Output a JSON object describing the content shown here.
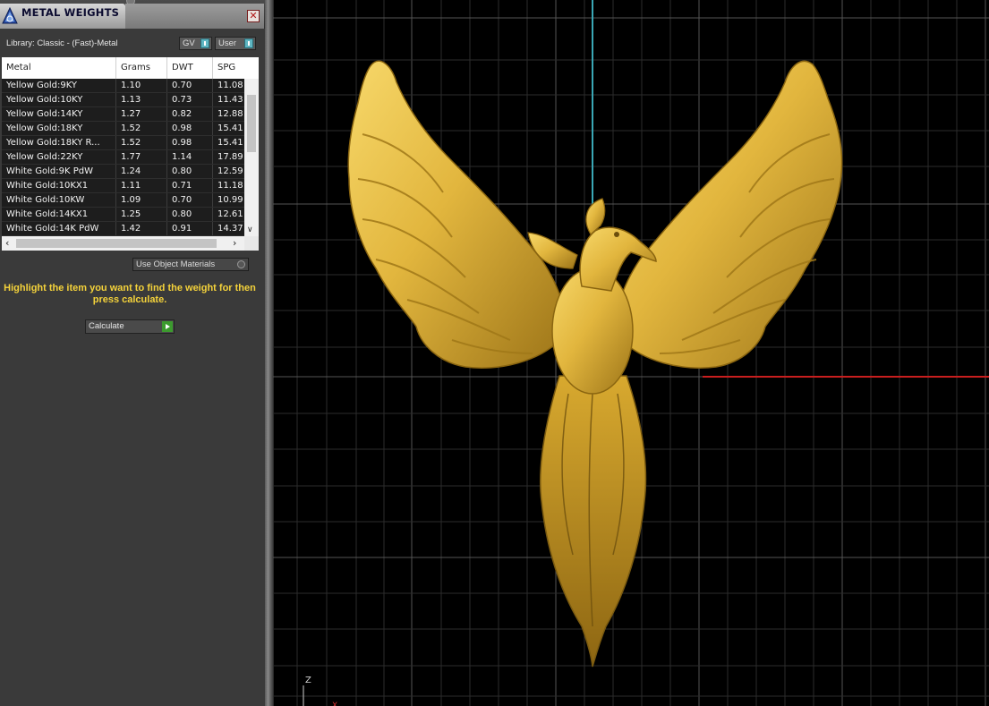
{
  "panel": {
    "title": "METAL WEIGHTS",
    "library": "Library: Classic - (Fast)-Metal",
    "gv_label": "GV",
    "user_label": "User",
    "columns": [
      "Metal",
      "Grams",
      "DWT",
      "SPG"
    ],
    "rows": [
      [
        "Yellow Gold:9KY",
        "1.10",
        "0.70",
        "11.08"
      ],
      [
        "Yellow Gold:10KY",
        "1.13",
        "0.73",
        "11.43"
      ],
      [
        "Yellow Gold:14KY",
        "1.27",
        "0.82",
        "12.88"
      ],
      [
        "Yellow Gold:18KY",
        "1.52",
        "0.98",
        "15.41"
      ],
      [
        "Yellow Gold:18KY R...",
        "1.52",
        "0.98",
        "15.41"
      ],
      [
        "Yellow Gold:22KY",
        "1.77",
        "1.14",
        "17.89"
      ],
      [
        "White Gold:9K PdW",
        "1.24",
        "0.80",
        "12.59"
      ],
      [
        "White Gold:10KX1",
        "1.11",
        "0.71",
        "11.18"
      ],
      [
        "White Gold:10KW",
        "1.09",
        "0.70",
        "10.99"
      ],
      [
        "White Gold:14KX1",
        "1.25",
        "0.80",
        "12.61"
      ],
      [
        "White Gold:14K PdW",
        "1.42",
        "0.91",
        "14.37"
      ]
    ],
    "use_object_materials": "Use Object Materials",
    "hint": "Highlight the item you want to find the weight for then press calculate.",
    "calculate_label": "Calculate"
  },
  "viewport": {
    "axis_label_z": "Z",
    "axis_label_x": "X",
    "model": "gold phoenix pendant",
    "colors": {
      "gold": "#e0b43c",
      "grid": "#3a3a3a",
      "axis_v": "#3aa7b5",
      "axis_h": "#d02020"
    }
  }
}
